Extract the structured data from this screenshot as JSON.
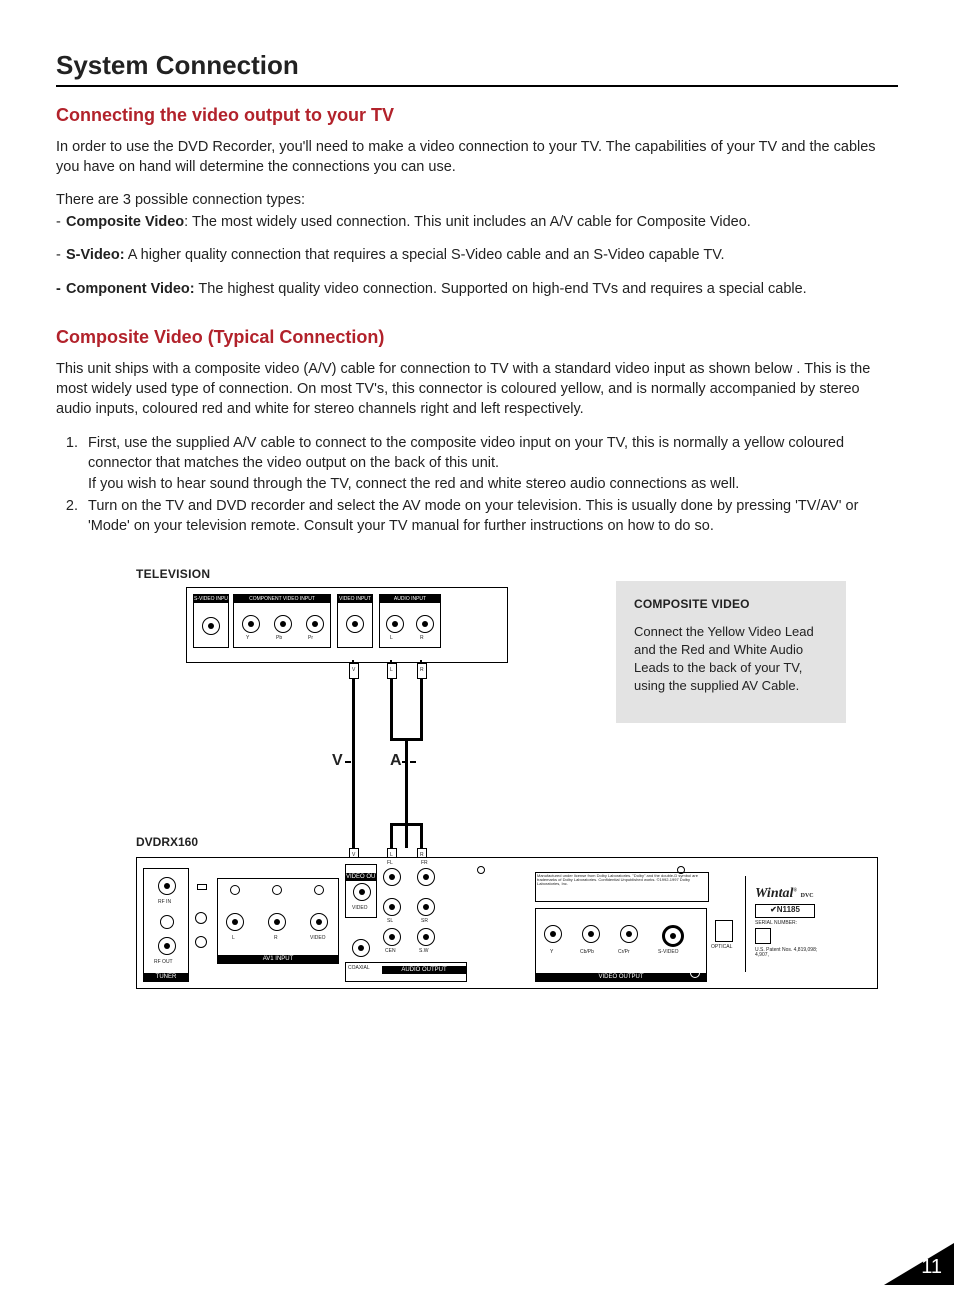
{
  "title": "System Connection",
  "section1": {
    "heading": "Connecting the video output to your TV",
    "intro": "In order to use the DVD Recorder, you'll need to make a video connection to your TV. The capabilities of your TV and the cables you have on hand will determine the connections you can use.",
    "types_lead": "There are 3 possible connection types:",
    "t1_label": "Composite Video",
    "t1_text": ": The most widely used connection. This unit includes an A/V cable for Composite Video.",
    "t2_label": "S-Video:",
    "t2_text": " A higher quality connection that requires a special S-Video cable and an S-Video capable TV.",
    "t3_label": "Component Video:",
    "t3_text": " The highest quality video connection. Supported on high-end TVs and requires a special cable."
  },
  "section2": {
    "heading": "Composite Video (Typical Connection)",
    "para": "This unit ships with a composite video (A/V) cable for connection to TV with a standard video input as shown below . This is the most widely used type of connection. On most TV's, this connector is coloured yellow, and is normally accompanied by stereo audio inputs, coloured red and white for stereo channels right and left respectively.",
    "step1a": "First, use the supplied A/V cable to connect to the composite video input on your TV, this is normally a yellow coloured connector that matches the video output on the back of this unit.",
    "step1b": "If you wish to hear sound through the TV, connect the red and white stereo audio connections as well.",
    "step2": "Turn on the TV and DVD recorder and select the AV mode on your television. This is usually done by pressing 'TV/AV' or 'Mode' on your television remote. Consult your TV manual for further instructions on how to do so."
  },
  "diagram": {
    "tv_label": "TELEVISION",
    "dvd_label": "DVDRX160",
    "marker_v": "V",
    "marker_a": "A",
    "tv_groups": {
      "svideo": "S-VIDEO INPUT",
      "component": "COMPONENT VIDEO INPUT",
      "video": "VIDEO INPUT",
      "audio": "AUDIO INPUT"
    },
    "tv_sub": {
      "y": "Y",
      "pb": "Pb",
      "pr": "Pr",
      "l": "L",
      "r": "R"
    },
    "plugs": {
      "v": "V",
      "l": "L",
      "r": "R"
    },
    "dvd_blocks": {
      "tuner": "TUNER",
      "rfin": "RF IN",
      "rfout": "RF OUT",
      "av1": "AV1 INPUT",
      "av1_l": "L",
      "av1_r": "R",
      "av1_v": "VIDEO",
      "vout": "VIDEO OUTPUT",
      "vout_video": "VIDEO",
      "aout": "AUDIO OUTPUT",
      "aout_coax": "COAXIAL",
      "mid_fl": "FL",
      "mid_fr": "FR",
      "mid_sl": "SL",
      "mid_sr": "SR",
      "mid_cen": "CEN",
      "mid_sw": "S.W",
      "vout2": "VIDEO OUTPUT",
      "vout2_y": "Y",
      "vout2_cb": "Cb/Pb",
      "vout2_cr": "Cr/Pr",
      "vout2_sv": "S-VIDEO",
      "optical": "OPTICAL",
      "dolby": "Manufactured under license from Dolby Laboratories. \"Dolby\" and the double-D symbol are trademarks of Dolby Laboratories. Confidential Unpublished works. ©1992-1997 Dolby Laboratories, Inc.",
      "brand": "Wintal",
      "brand_sub": "DVC",
      "model": "N1185",
      "serial": "SERIAL NUMBER:",
      "patent": "U.S. Patent Nos. 4,819,098; 4,907,"
    }
  },
  "infobox": {
    "title": "COMPOSITE VIDEO",
    "body": "Connect the Yellow Video Lead and the Red and White Audio Leads to the back of your TV, using the supplied AV Cable."
  },
  "page_number": "11"
}
